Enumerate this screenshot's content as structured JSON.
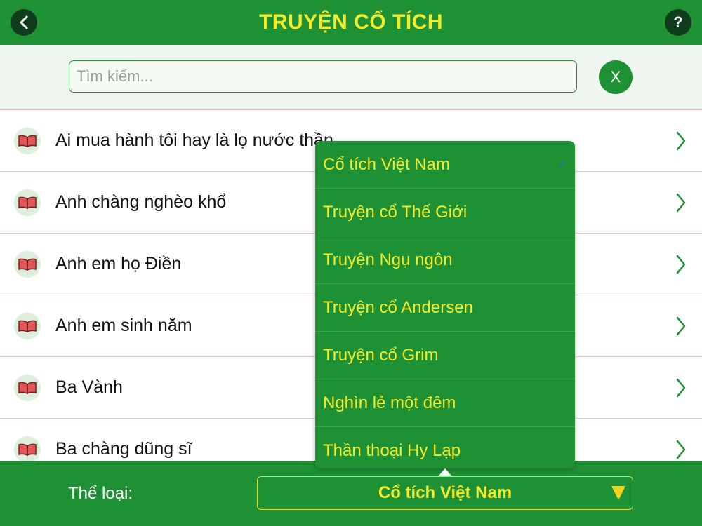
{
  "header": {
    "title": "TRUYỆN CỔ TÍCH",
    "help_label": "?"
  },
  "search": {
    "placeholder": "Tìm kiếm...",
    "value": "",
    "clear_label": "X"
  },
  "stories": [
    "Ai mua hành tôi hay là lọ nước thần",
    "Anh chàng nghèo khổ",
    "Anh em họ Điền",
    "Anh em sinh năm",
    "Ba Vành",
    "Ba chàng dũng sĩ"
  ],
  "footer": {
    "label": "Thể loại:",
    "selected": "Cổ tích Việt Nam"
  },
  "dropdown": {
    "options": [
      "Cổ tích Việt Nam",
      "Truyện cổ Thế Giới",
      "Truyện Ngụ ngôn",
      "Truyện cổ Andersen",
      "Truyện cổ Grim",
      "Nghìn lẻ một đêm",
      "Thần thoại Hy Lạp"
    ],
    "selected_index": 0,
    "check": "✓"
  },
  "colors": {
    "primary_green": "#1f9135",
    "accent_yellow": "#f3ea2a",
    "dark_circle": "#0f3d1c"
  }
}
